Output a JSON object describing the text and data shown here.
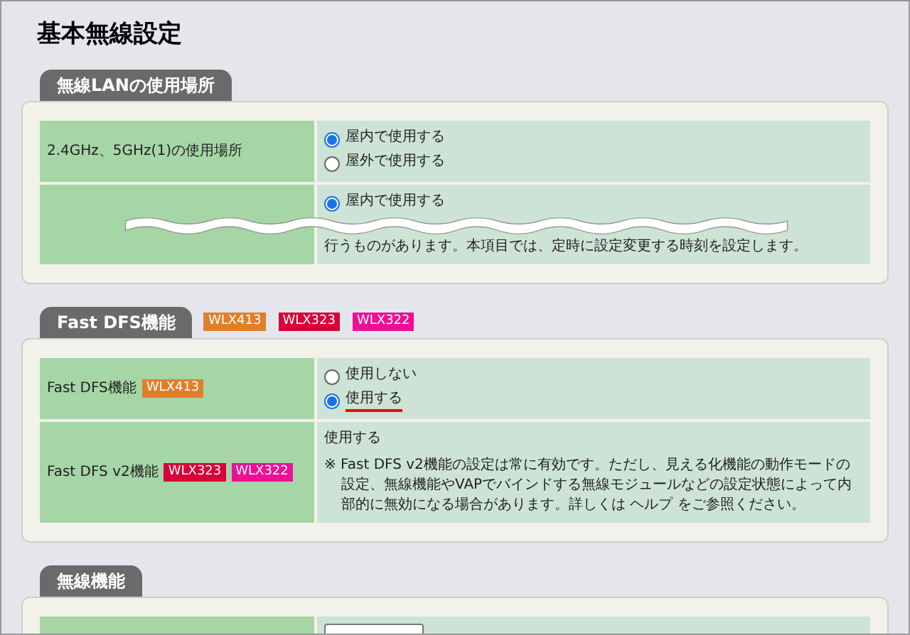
{
  "title": "基本無線設定",
  "sections": [
    {
      "title": "無線LANの使用場所",
      "rows": [
        {
          "label": "2.4GHz、5GHz(1)の使用場所",
          "control": {
            "kind": "radio",
            "options": [
              {
                "label": "屋内で使用する",
                "selected": true,
                "marked": false
              },
              {
                "label": "屋外で使用する",
                "selected": false,
                "marked": false
              }
            ]
          },
          "notes": []
        },
        {
          "control": {
            "kind": "radio",
            "options": [
              {
                "label": "屋内で使用する",
                "selected": true,
                "marked": false
              }
            ]
          },
          "torn": true,
          "notes": [
            "行うものがあります。本項目では、定時に設定変更する時刻を設定します。"
          ]
        }
      ]
    },
    {
      "title": "Fast DFS機能",
      "badges": [
        {
          "label": "WLX413",
          "color": "#e07f2a"
        },
        {
          "label": "WLX323",
          "color": "#d8003a"
        },
        {
          "label": "WLX322",
          "color": "#ee0f96"
        }
      ],
      "rows": [
        {
          "label": "Fast DFS機能",
          "badges": [
            {
              "label": "WLX413",
              "color": "#e07f2a"
            }
          ],
          "control": {
            "kind": "radio",
            "options": [
              {
                "label": "使用しない",
                "selected": false,
                "marked": false
              },
              {
                "label": "使用する",
                "selected": true,
                "marked": true
              }
            ]
          },
          "notes": []
        },
        {
          "label": "Fast DFS v2機能",
          "badges": [
            {
              "label": "WLX323",
              "color": "#d8003a"
            },
            {
              "label": "WLX322",
              "color": "#ee0f96"
            }
          ],
          "control": {
            "kind": "text",
            "value": "使用する"
          },
          "notes": [
            "※ Fast DFS v2機能の設定は常に有効です。ただし、見える化機能の動作モードの設定、無線機能やVAPでバインドする無線モジュールなどの設定状態によって内部的に無効になる場合があります。詳しくは ヘルプ をご参照ください。"
          ]
        }
      ]
    },
    {
      "title": "無線機能",
      "rows": [
        {
          "control": {
            "kind": "select"
          },
          "notes": []
        }
      ]
    }
  ]
}
